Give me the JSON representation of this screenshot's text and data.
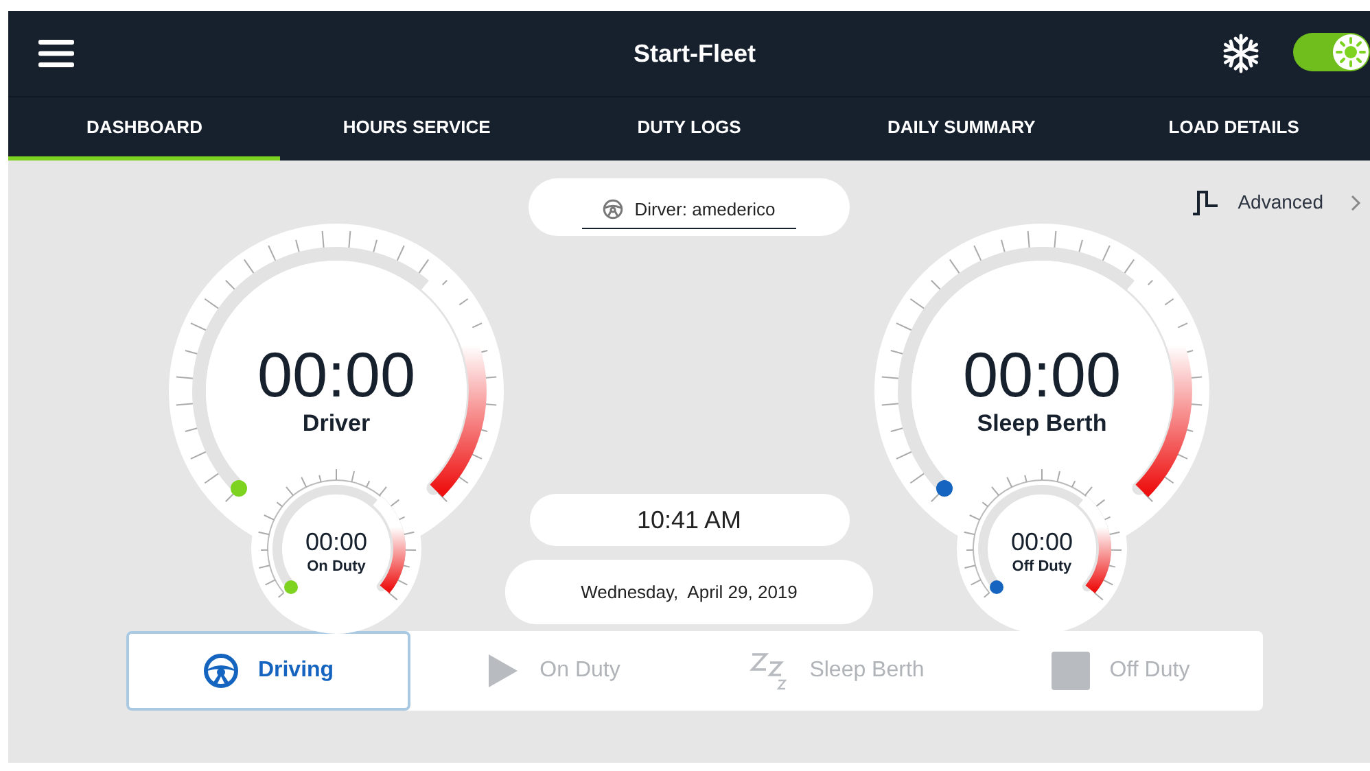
{
  "app_bar": {
    "title": "Start-Fleet",
    "toggle_on": true
  },
  "tabs": [
    {
      "label": "DASHBOARD",
      "selected": true
    },
    {
      "label": "HOURS SERVICE",
      "selected": false
    },
    {
      "label": "DUTY LOGS",
      "selected": false
    },
    {
      "label": "DAILY SUMMARY",
      "selected": false
    },
    {
      "label": "LOAD DETAILS",
      "selected": false
    }
  ],
  "driver_field": {
    "value": "Dirver: amederico"
  },
  "advanced_link": {
    "label": "Advanced"
  },
  "gauges": [
    {
      "time": "00:00",
      "label": "Driver",
      "color": "#7ed321",
      "sub_time": "00:00",
      "sub_label": "On Duty"
    },
    {
      "time": "00:00",
      "label": "Sleep Berth",
      "color": "#1565c0",
      "sub_time": "00:00",
      "sub_label": "Off Duty"
    }
  ],
  "clock": {
    "time": "10:41 AM",
    "date": "Wednesday,  April 29, 2019"
  },
  "status_buttons": [
    {
      "kind": "driving",
      "label": "Driving",
      "selected": true
    },
    {
      "kind": "on_duty",
      "label": "On Duty",
      "selected": false
    },
    {
      "kind": "sleep",
      "label": "Sleep Berth",
      "selected": false
    },
    {
      "kind": "off_duty",
      "label": "Off Duty",
      "selected": false
    }
  ]
}
